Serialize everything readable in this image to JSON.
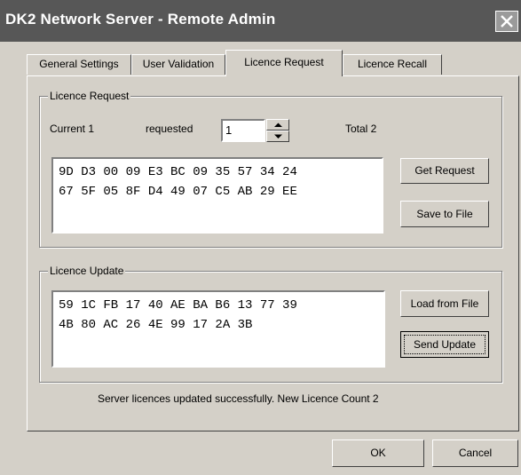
{
  "window": {
    "title": "DK2 Network Server - Remote Admin"
  },
  "tabs": [
    {
      "label": "General Settings"
    },
    {
      "label": "User Validation"
    },
    {
      "label": "Licence Request"
    },
    {
      "label": "Licence Recall"
    }
  ],
  "licence_request": {
    "group_label": "Licence Request",
    "current_label": "Current 1",
    "requested_label": "requested",
    "requested_value": "1",
    "total_label": "Total 2",
    "request_data": "9D D3 00 09 E3 BC 09 35 57 34 24\n67 5F 05 8F D4 49 07 C5 AB 29 EE",
    "get_request_button": "Get Request",
    "save_to_file_button": "Save to File"
  },
  "licence_update": {
    "group_label": "Licence Update",
    "update_data": "59 1C FB 17 40 AE BA B6 13 77 39\n4B 80 AC 26 4E 99 17 2A 3B",
    "load_from_file_button": "Load from File",
    "send_update_button": "Send Update"
  },
  "status_message": "Server licences updated successfully. New Licence Count 2",
  "buttons": {
    "ok": "OK",
    "cancel": "Cancel"
  }
}
